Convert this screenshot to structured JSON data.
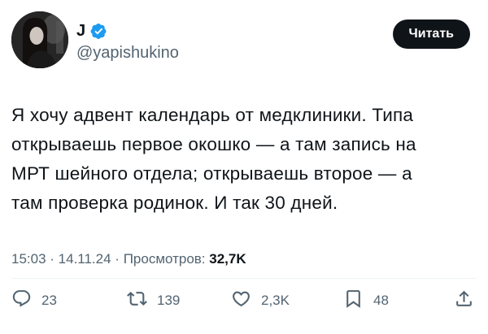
{
  "author": {
    "display_name": "J",
    "handle": "@yapishukino",
    "verified": true
  },
  "follow_button": {
    "label": "Читать"
  },
  "tweet": {
    "lines": [
      "Я хочу адвент календарь от медклиники. Типа",
      "открываешь первое окошко — а там запись на",
      "МРТ шейного отдела; открываешь второе — а",
      "там проверка родинок. И так 30 дней."
    ]
  },
  "meta": {
    "time": "15:03",
    "date": "14.11.24",
    "separator": " · ",
    "views_label": "Просмотров: ",
    "views_count": "32,7K"
  },
  "actions": {
    "replies": "23",
    "reposts": "139",
    "likes": "2,3K",
    "bookmarks": "48"
  },
  "colors": {
    "verified": "#1d9bf0",
    "text_secondary": "#536471",
    "button_bg": "#0f1419"
  },
  "icons": [
    "verified-badge-icon",
    "reply-icon",
    "repost-icon",
    "like-icon",
    "bookmark-icon",
    "share-icon"
  ]
}
